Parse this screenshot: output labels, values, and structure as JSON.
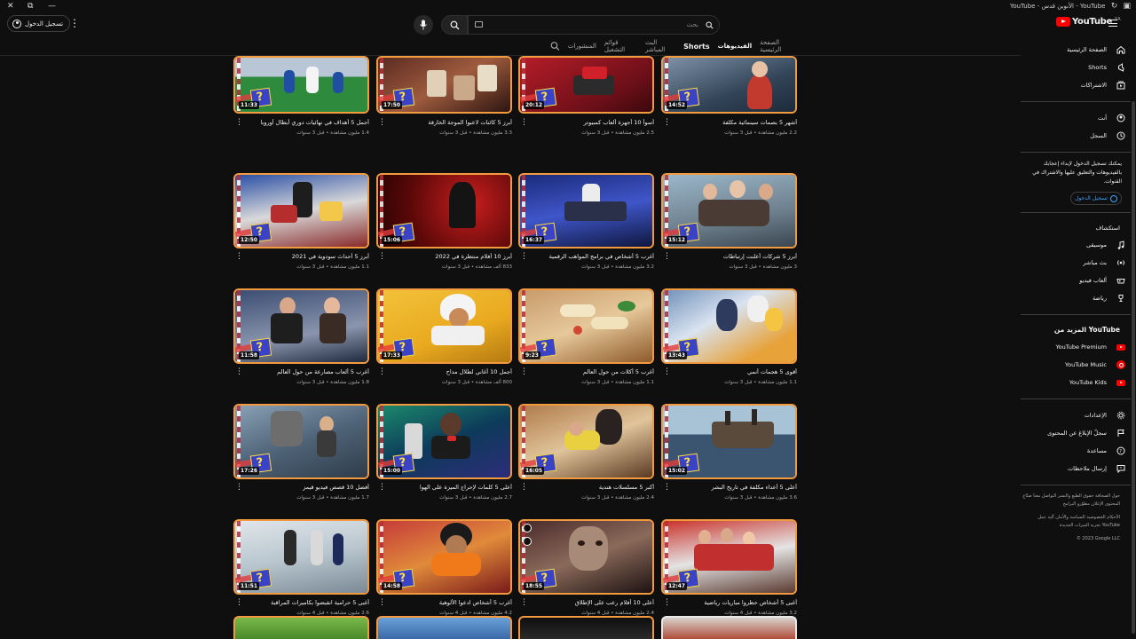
{
  "window": {
    "title": "YouTube - الأنوبن قدس - YouTube",
    "controls": [
      "✕",
      "⧉",
      "—"
    ]
  },
  "masthead": {
    "signin_label": "تسجيل الدخول",
    "search_placeholder": "بحث",
    "logo_text": "YouTube",
    "logo_country": "SA"
  },
  "chips": [
    {
      "label": "الصفحة الرئيسية",
      "selected": false
    },
    {
      "label": "الفيديوهات",
      "selected": true
    },
    {
      "label": "Shorts",
      "selected": false
    },
    {
      "label": "البث المباشر",
      "selected": false
    },
    {
      "label": "قوائم التشغيل",
      "selected": false
    },
    {
      "label": "المنشورات",
      "selected": false
    }
  ],
  "videos": [
    {
      "title": "أشهر 5 بصمات سينمائية مكلفة",
      "stats": "2.2 مليون مشاهدة • قبل 3 سنوات",
      "duration": "14:52",
      "scene": "hero"
    },
    {
      "title": "أسوأ 10 أجهزة ألعاب كمبيوتر",
      "stats": "2.5 مليون مشاهدة • قبل 3 سنوات",
      "duration": "20:12",
      "scene": "console"
    },
    {
      "title": "أبرز 5 كائنات لاعبوا الموجة الخارقة",
      "stats": "3.3 مليون مشاهدة • قبل 3 سنوات",
      "duration": "17:50",
      "scene": "cards"
    },
    {
      "title": "أجمل 5 أهداف في نهائيات دوري أبطال أوروبا",
      "stats": "1.4 مليون مشاهدة • قبل 3 سنوات",
      "duration": "11:33",
      "scene": "football"
    },
    {
      "title": "أبرز 5 شركات أعلنت إرتباطات",
      "stats": "3 مليون مشاهدة • قبل 3 سنوات",
      "duration": "15:12",
      "scene": "crowd"
    },
    {
      "title": "أغرب 5 أشخاص في برامج المواهب الرقمية",
      "stats": "3.2 مليون مشاهدة • قبل 3 سنوات",
      "duration": "16:37",
      "scene": "stage"
    },
    {
      "title": "أبرز 10 أفلام منتظرة في 2022",
      "stats": "833 ألف مشاهدة • قبل 3 سنوات",
      "duration": "15:06",
      "scene": "batman"
    },
    {
      "title": "أبرز 5 أحداث سودوية في 2021",
      "stats": "1.1 مليون مشاهدة • قبل 3 سنوات",
      "duration": "12:50",
      "scene": "event"
    },
    {
      "title": "أقوى 5 هجمات أنمي",
      "stats": "1.1 مليون مشاهدة • قبل 3 سنوات",
      "duration": "13:43",
      "scene": "anime"
    },
    {
      "title": "أغرب 5 أكلات من حول العالم",
      "stats": "1.1 مليون مشاهدة • قبل 3 سنوات",
      "duration": "9:23",
      "scene": "food"
    },
    {
      "title": "أجمل 10 أغاني لطلال مداح",
      "stats": "800 ألف مشاهدة • قبل 3 سنوات",
      "duration": "17:33",
      "scene": "singer"
    },
    {
      "title": "أغرب 5 ألعاب مصارعة من حول العالم",
      "stats": "1.8 مليون مشاهدة • قبل 3 سنوات",
      "duration": "11:58",
      "scene": "fight"
    },
    {
      "title": "أعلى 5 أعداء مكلفة في تاريخ البشر",
      "stats": "3.6 مليون مشاهدة • قبل 3 سنوات",
      "duration": "15:02",
      "scene": "ship"
    },
    {
      "title": "أكبر 5 مسلسلات هندية",
      "stats": "2.4 مليون مشاهدة • قبل 3 سنوات",
      "duration": "16:05",
      "scene": "gorilla"
    },
    {
      "title": "أعلى 5 كلمات لإحراج الميزة على الهوا",
      "stats": "2.7 مليون مشاهدة • قبل 3 سنوات",
      "duration": "15:00",
      "scene": "news"
    },
    {
      "title": "أفضل 10 قصص فيديو قيمز",
      "stats": "1.7 مليون مشاهدة • قبل 3 سنوات",
      "duration": "17:26",
      "scene": "game"
    },
    {
      "title": "أغبى 5 أشخاص حظروا مباريات رياضية",
      "stats": "3.2 مليون مشاهدة • قبل 4 سنوات",
      "duration": "12:47",
      "scene": "fans"
    },
    {
      "title": "أعلى 10 أفلام رعب على الإطلاق",
      "stats": "2.4 مليون مشاهدة • قبل 4 سنوات",
      "duration": "18:55",
      "scene": "horror"
    },
    {
      "title": "أغرب 5 أشخاص ادعوا الألوهية",
      "stats": "4.2 مليون مشاهدة • قبل 4 سنوات",
      "duration": "14:58",
      "scene": "guru"
    },
    {
      "title": "أغبى 5 حرامية انقبضوا بكاميرات المراقبة",
      "stats": "2.6 مليون مشاهدة • قبل 4 سنوات",
      "duration": "11:51",
      "scene": "thief"
    }
  ],
  "sidebar": {
    "main": [
      {
        "label": "الصفحة الرئيسية",
        "icon": "home-icon"
      },
      {
        "label": "Shorts",
        "icon": "shorts-icon"
      },
      {
        "label": "الاشتراكات",
        "icon": "subscriptions-icon"
      }
    ],
    "you": [
      {
        "label": "أنت",
        "icon": "you-icon"
      },
      {
        "label": "السجل",
        "icon": "history-icon"
      }
    ],
    "promo_text": "يمكنك تسجيل الدخول لإبداء إعجابك بالفيديوهات والتعليق عليها والاشتراك في القنوات.",
    "promo_signin": "تسجيل الدخول",
    "explore_heading": "استكشاف",
    "explore": [
      {
        "label": "موسيقى",
        "icon": "music-icon"
      },
      {
        "label": "بث مباشر",
        "icon": "live-icon"
      },
      {
        "label": "ألعاب فيديو",
        "icon": "gaming-icon"
      },
      {
        "label": "رياضة",
        "icon": "trophy-icon"
      }
    ],
    "more_heading": "المزيد من YouTube",
    "more": [
      {
        "label": "YouTube Premium",
        "icon": "youtube-premium-icon"
      },
      {
        "label": "YouTube Music",
        "icon": "youtube-music-icon"
      },
      {
        "label": "YouTube Kids",
        "icon": "youtube-kids-icon"
      }
    ],
    "settings": [
      {
        "label": "الإعدادات",
        "icon": "settings-icon"
      },
      {
        "label": "سجلّ الإبلاغ عن المحتوى",
        "icon": "flag-icon"
      },
      {
        "label": "مساعدة",
        "icon": "help-icon"
      },
      {
        "label": "إرسال ملاحظات",
        "icon": "feedback-icon"
      }
    ],
    "footer_links_1": "حول  الصحافة  حقوق الطبع والنشر  التواصل معنا  صنّاع المحتوى  الإعلان  مطوّرو البرامج",
    "footer_links_2": "الأحكام  الخصوصية  السياسة والأمان  آلية عمل YouTube  تجربة الميزات الجديدة",
    "copyright": "© 2023 Google LLC"
  },
  "colors": {
    "background": "#0f0f0f",
    "thumb_frame": "#f29a40",
    "accent_red": "#ff0000",
    "link_blue": "#3ea6ff"
  }
}
